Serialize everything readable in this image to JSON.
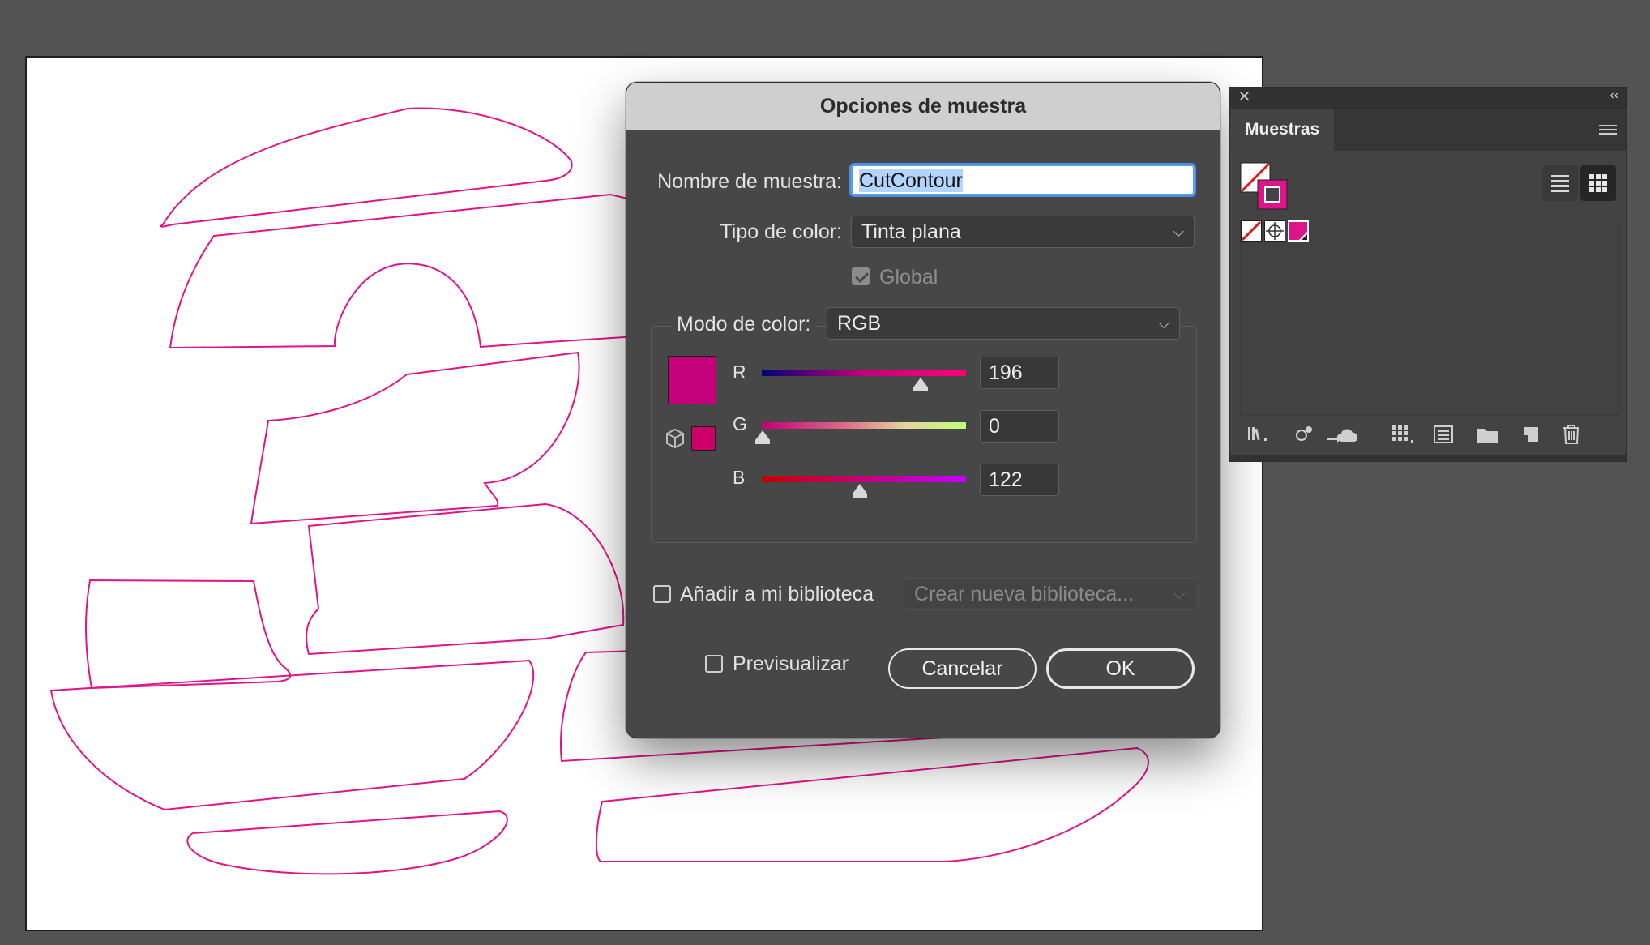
{
  "dialog": {
    "title": "Opciones de muestra",
    "name_label": "Nombre de muestra:",
    "name_value": "CutContour",
    "color_type_label": "Tipo de color:",
    "color_type_value": "Tinta plana",
    "global_label": "Global",
    "global_checked": true,
    "global_disabled": true,
    "color_mode_label": "Modo de color:",
    "color_mode_value": "RGB",
    "channels": [
      {
        "name": "R",
        "value": "196"
      },
      {
        "name": "G",
        "value": "0"
      },
      {
        "name": "B",
        "value": "122"
      }
    ],
    "color_hex": "#c4007a",
    "add_library_label": "Añadir a mi biblioteca",
    "add_library_checked": false,
    "library_placeholder": "Crear nueva biblioteca...",
    "preview_label": "Previsualizar",
    "preview_checked": false,
    "cancel_label": "Cancelar",
    "ok_label": "OK"
  },
  "panel": {
    "tab_label": "Muestras",
    "swatches": [
      "none",
      "registration",
      "cutcontour-spot"
    ]
  },
  "artwork": {
    "stroke_color": "#e0148a"
  }
}
